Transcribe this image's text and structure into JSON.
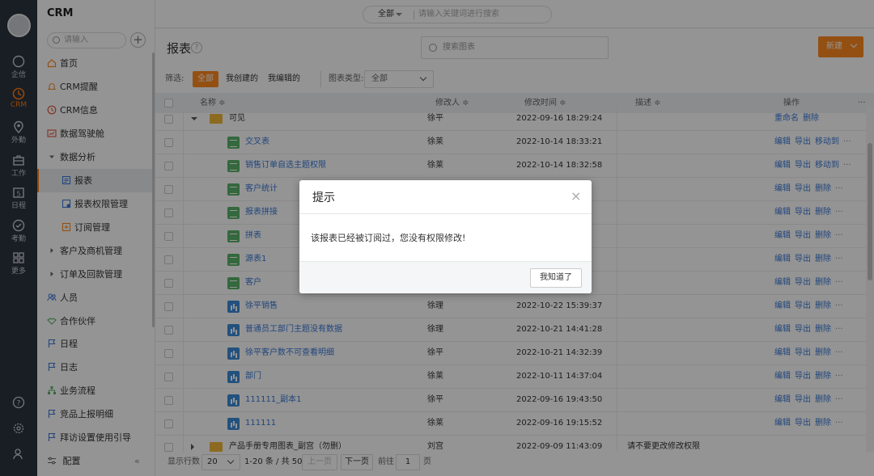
{
  "rail": {
    "items": [
      {
        "label": "企信",
        "icon": "chat-icon"
      },
      {
        "label": "CRM",
        "icon": "clock-icon"
      },
      {
        "label": "外勤",
        "icon": "location-pin-icon"
      },
      {
        "label": "工作",
        "icon": "briefcase-icon"
      },
      {
        "label": "日程",
        "icon": "calendar-icon",
        "day": "5"
      },
      {
        "label": "考勤",
        "icon": "check-circle-icon"
      },
      {
        "label": "更多",
        "icon": "grid-icon"
      }
    ]
  },
  "sidebar": {
    "title": "CRM",
    "search_placeholder": "请输入",
    "plus": "+",
    "items": [
      {
        "label": "首页",
        "icon": "home-icon"
      },
      {
        "label": "CRM提醒",
        "icon": "bell-icon"
      },
      {
        "label": "CRM信息",
        "icon": "clock-icon"
      },
      {
        "label": "数据驾驶舱",
        "icon": "dashboard-icon"
      },
      {
        "label": "数据分析",
        "icon": "caret-down-icon"
      },
      {
        "label": "报表",
        "icon": "report-icon"
      },
      {
        "label": "报表权限管理",
        "icon": "report-permission-icon"
      },
      {
        "label": "订阅管理",
        "icon": "subscription-icon"
      },
      {
        "label": "客户及商机管理",
        "icon": "caret-right-icon"
      },
      {
        "label": "订单及回款管理",
        "icon": "caret-right-icon"
      },
      {
        "label": "人员",
        "icon": "people-icon"
      },
      {
        "label": "合作伙伴",
        "icon": "handshake-icon"
      },
      {
        "label": "日程",
        "icon": "flag-icon"
      },
      {
        "label": "日志",
        "icon": "flag-icon"
      },
      {
        "label": "业务流程",
        "icon": "org-chart-icon"
      },
      {
        "label": "竞品上报明细",
        "icon": "flag-icon"
      },
      {
        "label": "拜访设置使用引导",
        "icon": "flag-icon"
      }
    ],
    "footer_label": "配置",
    "collapse": "«"
  },
  "topbar": {
    "scope": "全部",
    "search_placeholder": "请输入关键词进行搜索"
  },
  "main": {
    "title": "报表",
    "help": "?",
    "search_placeholder": "搜索图表",
    "new_button": "新建",
    "filter_label": "筛选:",
    "filter_chips": [
      "全部",
      "我创建的",
      "我编辑的"
    ],
    "type_label": "图表类型:",
    "type_value": "全部",
    "columns": {
      "name": "名称 ≑",
      "modifier": "修改人 ≑",
      "modified_time": "修改时间 ≑",
      "description": "描述 ≑",
      "actions": "操作",
      "more": "···"
    },
    "rows": [
      {
        "kind": "folder",
        "name": "可见",
        "modifier": "徐平",
        "time": "2022-09-16 18:29:24",
        "ops": [
          "重命名",
          "删除"
        ],
        "more": ""
      },
      {
        "kind": "table",
        "name": "交叉表",
        "modifier": "徐莱",
        "time": "2022-10-14 18:33:21",
        "ops": [
          "编辑",
          "导出",
          "移动到"
        ],
        "more": "···"
      },
      {
        "kind": "table",
        "name": "销售订单自选主题权限",
        "modifier": "徐莱",
        "time": "2022-10-14 18:32:58",
        "ops": [
          "编辑",
          "导出",
          "移动到"
        ],
        "more": "···"
      },
      {
        "kind": "table",
        "name": "客户统计",
        "modifier": "",
        "time": "",
        "ops": [
          "编辑",
          "导出",
          "删除"
        ],
        "more": "···"
      },
      {
        "kind": "table",
        "name": "报表拼接",
        "modifier": "",
        "time": "",
        "ops": [
          "编辑",
          "导出",
          "删除"
        ],
        "more": "···"
      },
      {
        "kind": "table",
        "name": "拼表",
        "modifier": "",
        "time": "",
        "ops": [
          "编辑",
          "导出",
          "删除"
        ],
        "more": "···"
      },
      {
        "kind": "table",
        "name": "源表1",
        "modifier": "",
        "time": "",
        "ops": [
          "编辑",
          "导出",
          "删除"
        ],
        "more": "···"
      },
      {
        "kind": "table",
        "name": "客户",
        "modifier": "",
        "time": "",
        "ops": [
          "编辑",
          "导出",
          "删除"
        ],
        "more": "···"
      },
      {
        "kind": "chart",
        "name": "徐平销售",
        "modifier": "徐理",
        "time": "2022-10-22 15:39:37",
        "ops": [
          "编辑",
          "导出",
          "删除"
        ],
        "more": "···"
      },
      {
        "kind": "chart",
        "name": "普通员工部门主题没有数据",
        "modifier": "徐理",
        "time": "2022-10-21 14:41:28",
        "ops": [
          "编辑",
          "导出",
          "删除"
        ],
        "more": "···"
      },
      {
        "kind": "chart",
        "name": "徐平客户数不可查看明细",
        "modifier": "徐平",
        "time": "2022-10-21 14:32:39",
        "ops": [
          "编辑",
          "导出",
          "删除"
        ],
        "more": "···"
      },
      {
        "kind": "chart",
        "name": "部门",
        "modifier": "徐莱",
        "time": "2022-10-11 14:37:04",
        "ops": [
          "编辑",
          "导出",
          "删除"
        ],
        "more": "···"
      },
      {
        "kind": "chart",
        "name": "111111_副本1",
        "modifier": "徐平",
        "time": "2022-09-16 19:43:50",
        "ops": [
          "编辑",
          "导出",
          "删除"
        ],
        "more": "···"
      },
      {
        "kind": "chart",
        "name": "111111",
        "modifier": "徐莱",
        "time": "2022-09-16 19:15:52",
        "ops": [
          "编辑",
          "导出",
          "删除"
        ],
        "more": "···"
      },
      {
        "kind": "folder2",
        "name": "产品手册专用图表_副宫（勿删）",
        "modifier": "刘宫",
        "time": "2022-09-09 11:43:09",
        "desc": "请不要更改修改权限",
        "ops": [],
        "more": ""
      }
    ],
    "pager": {
      "rows_label": "显示行数",
      "page_size": "20",
      "range": "1-20 条 / 共 50 条",
      "prev": "上一页",
      "next": "下一页",
      "goto": "前往",
      "page": "1",
      "page_suffix": "页"
    }
  },
  "dialog": {
    "title": "提示",
    "close": "×",
    "message": "该报表已经被订阅过，您没有权限修改!",
    "ok_button": "我知道了"
  },
  "colors": {
    "accent": "#ff8a1f",
    "link": "#3a78d6",
    "rail_bg": "#2b3440"
  }
}
